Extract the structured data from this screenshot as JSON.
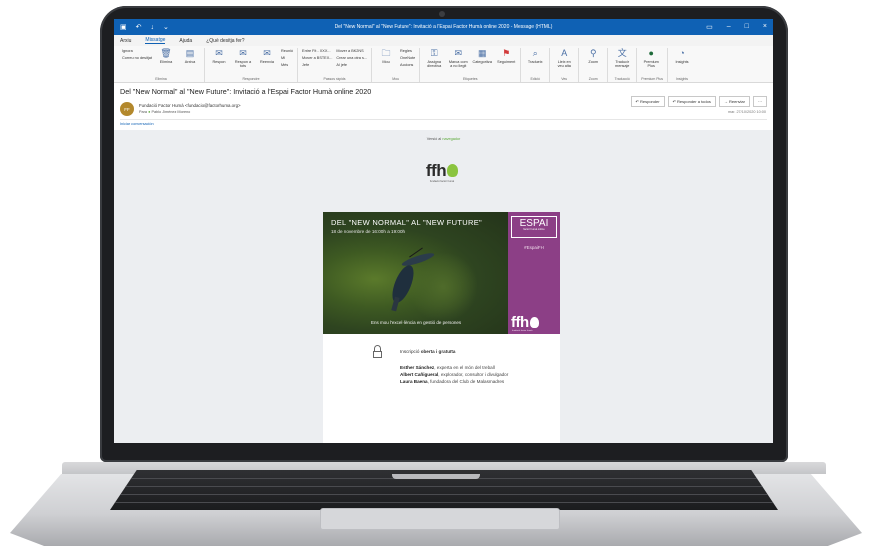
{
  "window": {
    "title": "Del \"New Normal\" al \"New Future\": Invitació a l'Espai Factor Humà online 2020 - Message (HTML)",
    "quick_icons": [
      "save-icon",
      "undo-icon",
      "redo-icon",
      "more-icon"
    ]
  },
  "ribbon": {
    "tabs": [
      {
        "label": "Arxiu"
      },
      {
        "label": "Missatge"
      },
      {
        "label": "Ajuda"
      },
      {
        "label": "¿Què desitja fer?"
      }
    ],
    "groups": {
      "delete": {
        "name": "Elimina",
        "ignore": "Ignora",
        "cleanup": "Correu no desitjat",
        "delete": "Elimina",
        "archive": "Arxiva"
      },
      "respond": {
        "name": "Respondre",
        "reply": "Respon",
        "reply_all": "Respon a tots",
        "forward": "Reenvia",
        "meeting": "Reunió",
        "im": "MI",
        "more": "Més"
      },
      "quick": {
        "name": "Passos ràpids",
        "items": [
          "Entre Fit - XXX...",
          "Mover a BSTEX...",
          "Jefe",
          "Mover a BK2NS",
          "Crear una otra s...",
          "Al jefe"
        ]
      },
      "move": {
        "name": "Mou",
        "move": "Mou",
        "rules": "Regles",
        "onenote": "OneNote",
        "actions": "Accions"
      },
      "tags": {
        "name": "Etiquetes",
        "assign": "Assigna directiva",
        "unread": "Marca com a no llegit",
        "categorize": "Categoritza",
        "followup": "Seguiment"
      },
      "edit": {
        "name": "Edició",
        "translate": "Tradueix"
      },
      "speech": {
        "name": "Veu",
        "read": "Lleix en veu alta"
      },
      "zoom": {
        "name": "Zoom",
        "zoom": "Zoom"
      },
      "translate": {
        "name": "Traducció",
        "translate": "Traducir mensaje"
      },
      "premium": {
        "name": "Premium Plus",
        "item": "Premium Plus"
      },
      "insights": {
        "name": "Insights",
        "item": "Insights"
      }
    }
  },
  "message": {
    "subject": "Del \"New Normal\" al \"New Future\": Invitació a l'Espai Factor Humà online 2020",
    "avatar_initials": "FF",
    "sender": "Fundació Factor Humà <fundacio@factorhuma.org>",
    "to_label": "Para",
    "to": "Pablo Jiménez Moreno",
    "date": "mar. 27/10/2020 10:00",
    "actions": {
      "reply": "Responder",
      "reply_all": "Responder a todos",
      "forward": "Reenviar",
      "more": "···"
    },
    "infobar": "Iniciar conversación"
  },
  "email": {
    "web_version_prefix": "Versió al",
    "web_version_link": "navegador",
    "logo": "ffh",
    "logo_sub": "fundació factor humà",
    "banner": {
      "title": "DEL \"NEW NORMAL\" AL \"NEW FUTURE\"",
      "date": "18 de novembre de 16:00h a 19:00h",
      "caption": "Ens mou l'excel·lència en gestió de persones",
      "espai": "ESPAI",
      "espai_sub": "factor humà online",
      "hashtag": "#EspaiFH",
      "side_logo": "ffh",
      "side_logo_sub": "fundació factor humà"
    },
    "inscription_prefix": "Inscripció",
    "inscription_bold": "oberta i gratuïta",
    "speakers": [
      {
        "name": "Esther Sánchez",
        "desc": ", experta en el món del treball"
      },
      {
        "name": "Albert Cañigueral",
        "desc": ", explorador, consultor i divulgador"
      },
      {
        "name": "Laura Baena",
        "desc": ", fundadora del Club de Malasmadres"
      }
    ]
  },
  "colors": {
    "titlebar": "#0f61b4",
    "brand_green": "#8bc43f",
    "brand_purple": "#8c3f86"
  }
}
